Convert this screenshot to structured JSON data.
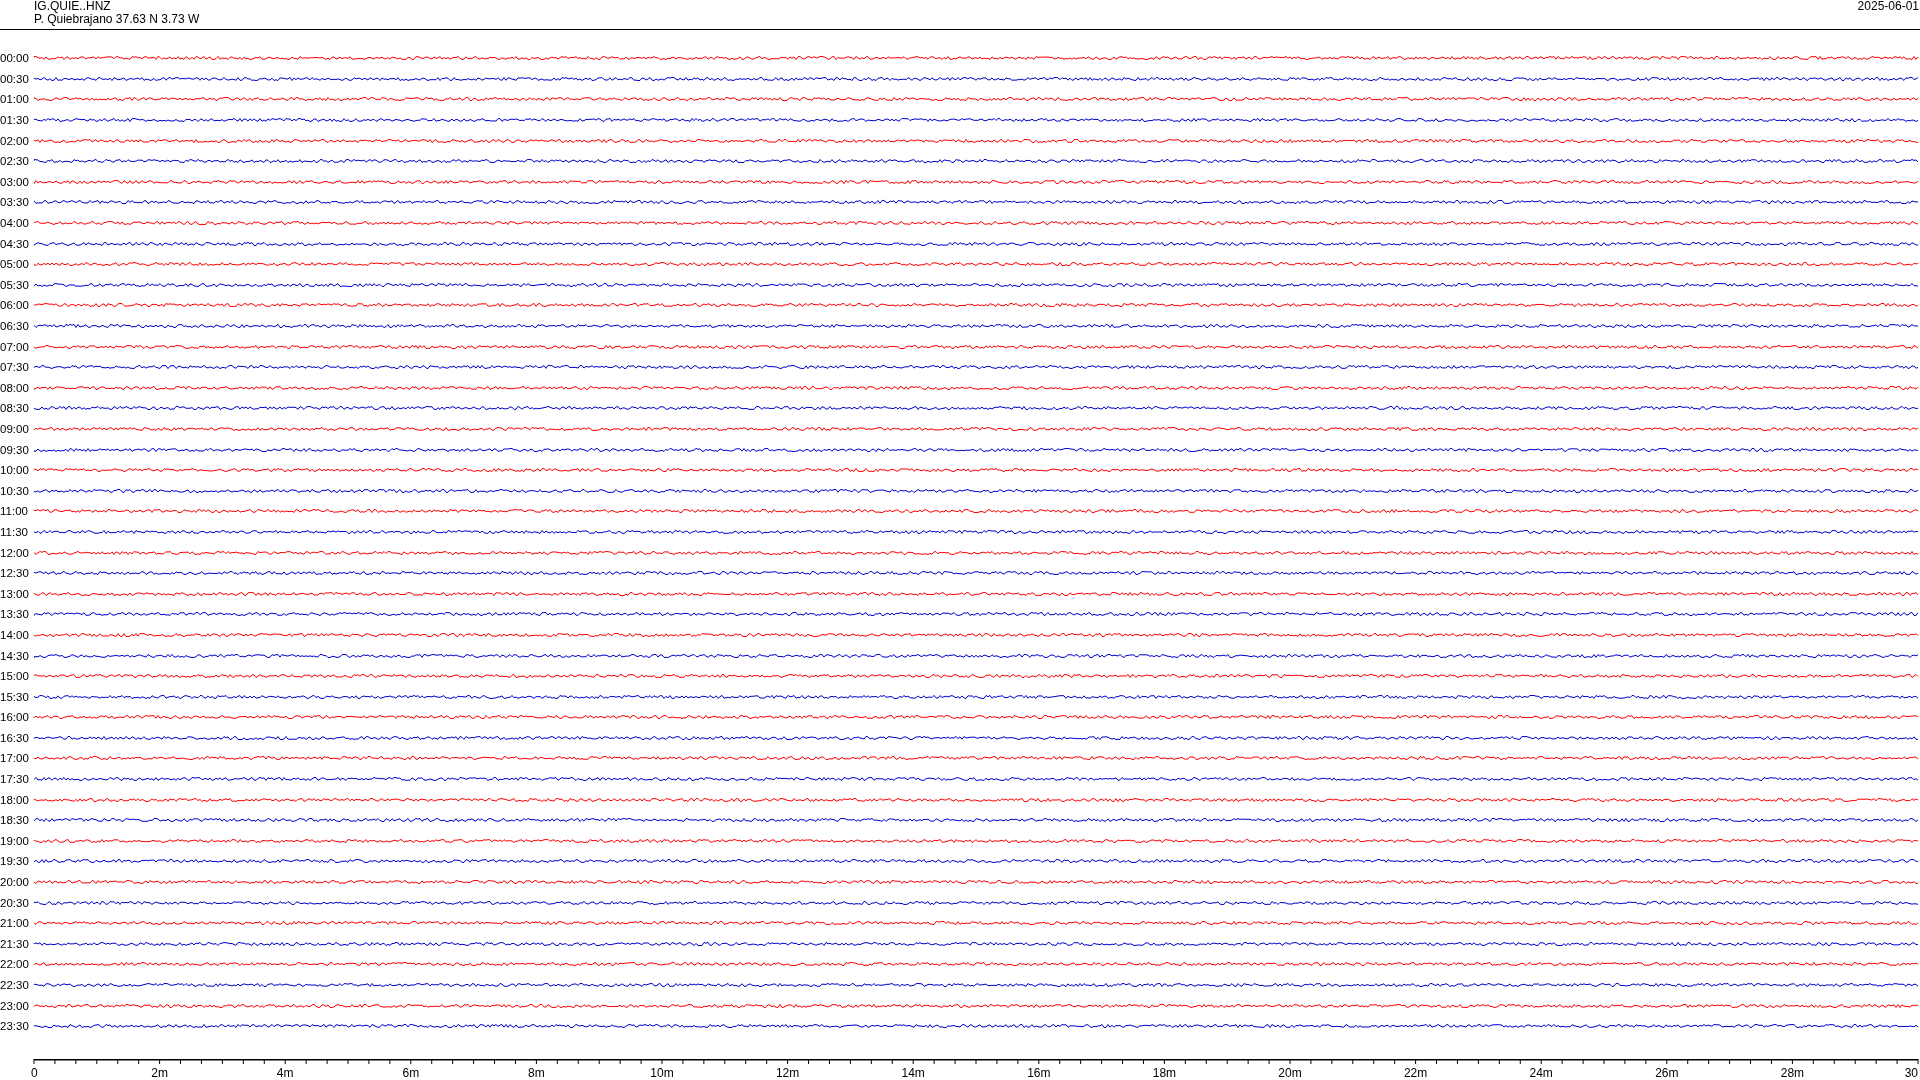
{
  "header": {
    "station": "IG.QUIE..HNZ",
    "location": "P. Quiebrajano  37.63 N 3.73 W",
    "date": "2025-06-01"
  },
  "rows": [
    {
      "label": "00:00",
      "color": "#ff0000"
    },
    {
      "label": "00:30",
      "color": "#0000cc"
    },
    {
      "label": "01:00",
      "color": "#ff0000"
    },
    {
      "label": "01:30",
      "color": "#0000cc"
    },
    {
      "label": "02:00",
      "color": "#ff0000"
    },
    {
      "label": "02:30",
      "color": "#0000cc"
    },
    {
      "label": "03:00",
      "color": "#ff0000"
    },
    {
      "label": "03:30",
      "color": "#0000cc"
    },
    {
      "label": "04:00",
      "color": "#ff0000"
    },
    {
      "label": "04:30",
      "color": "#0000cc"
    },
    {
      "label": "05:00",
      "color": "#ff0000"
    },
    {
      "label": "05:30",
      "color": "#0000cc"
    },
    {
      "label": "06:00",
      "color": "#ff0000"
    },
    {
      "label": "06:30",
      "color": "#0000cc"
    },
    {
      "label": "07:00",
      "color": "#ff0000"
    },
    {
      "label": "07:30",
      "color": "#0000cc"
    },
    {
      "label": "08:00",
      "color": "#ff0000"
    },
    {
      "label": "08:30",
      "color": "#0000cc"
    },
    {
      "label": "09:00",
      "color": "#ff0000"
    },
    {
      "label": "09:30",
      "color": "#0000cc"
    },
    {
      "label": "10:00",
      "color": "#ff0000"
    },
    {
      "label": "10:30",
      "color": "#0000cc"
    },
    {
      "label": "11:00",
      "color": "#ff0000"
    },
    {
      "label": "11:30",
      "color": "#0000cc"
    },
    {
      "label": "12:00",
      "color": "#ff0000"
    },
    {
      "label": "12:30",
      "color": "#0000cc"
    },
    {
      "label": "13:00",
      "color": "#ff0000"
    },
    {
      "label": "13:30",
      "color": "#0000cc"
    },
    {
      "label": "14:00",
      "color": "#ff0000"
    },
    {
      "label": "14:30",
      "color": "#0000cc"
    },
    {
      "label": "15:00",
      "color": "#ff0000"
    },
    {
      "label": "15:30",
      "color": "#0000cc"
    },
    {
      "label": "16:00",
      "color": "#ff0000"
    },
    {
      "label": "16:30",
      "color": "#0000cc"
    },
    {
      "label": "17:00",
      "color": "#ff0000"
    },
    {
      "label": "17:30",
      "color": "#0000cc"
    },
    {
      "label": "18:00",
      "color": "#ff0000"
    },
    {
      "label": "18:30",
      "color": "#0000cc"
    },
    {
      "label": "19:00",
      "color": "#ff0000"
    },
    {
      "label": "19:30",
      "color": "#0000cc"
    },
    {
      "label": "20:00",
      "color": "#ff0000"
    },
    {
      "label": "20:30",
      "color": "#0000cc"
    },
    {
      "label": "21:00",
      "color": "#ff0000"
    },
    {
      "label": "21:30",
      "color": "#0000cc"
    },
    {
      "label": "22:00",
      "color": "#ff0000"
    },
    {
      "label": "22:30",
      "color": "#0000cc"
    },
    {
      "label": "23:00",
      "color": "#ff0000"
    },
    {
      "label": "23:30",
      "color": "#0000cc"
    }
  ],
  "axis": {
    "ticks": [
      "0",
      "2m",
      "4m",
      "6m",
      "8m",
      "10m",
      "12m",
      "14m",
      "16m",
      "18m",
      "20m",
      "22m",
      "24m",
      "26m",
      "28m",
      "30"
    ]
  }
}
